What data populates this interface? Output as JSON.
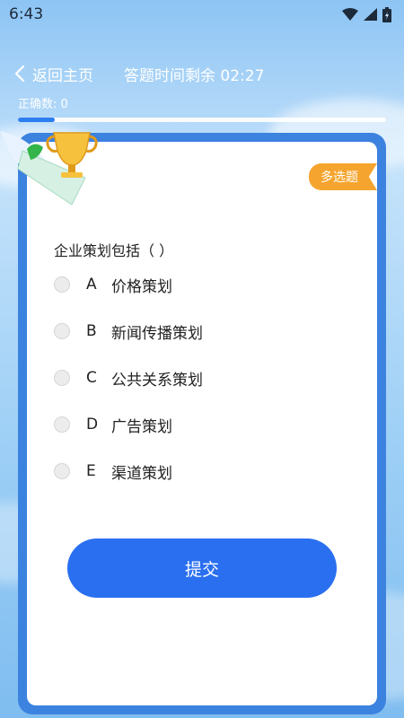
{
  "status": {
    "time": "6:43"
  },
  "header": {
    "back_label": "返回主页",
    "timer_label": "答题时间剩余 02:27"
  },
  "score": {
    "correct_label": "正确数: 0",
    "progress": 0.1
  },
  "question": {
    "tag": "多选题",
    "text": "企业策划包括（ ）",
    "options": [
      {
        "letter": "A",
        "text": "价格策划"
      },
      {
        "letter": "B",
        "text": "新闻传播策划"
      },
      {
        "letter": "C",
        "text": "公共关系策划"
      },
      {
        "letter": "D",
        "text": "广告策划"
      },
      {
        "letter": "E",
        "text": "渠道策划"
      }
    ]
  },
  "submit_label": "提交",
  "colors": {
    "accent": "#2a6ff0",
    "card_border": "#3c82df",
    "tag": "#f5a52f"
  },
  "icons": [
    "wifi-icon",
    "signal-icon",
    "battery-icon",
    "back-chevron-icon",
    "trophy-icon"
  ]
}
